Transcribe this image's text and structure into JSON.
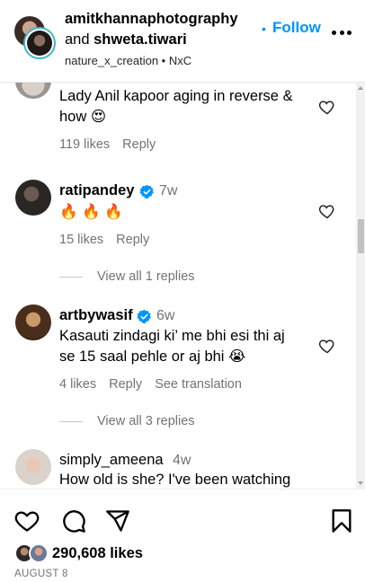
{
  "header": {
    "user1": "amitkhannaphotography",
    "and_text": "and",
    "user2": "shweta.tiwari",
    "follow_dot": "•",
    "follow_label": "Follow",
    "subtitle": "nature_x_creation • NxC"
  },
  "comments": [
    {
      "username": "",
      "time": "",
      "text_line1": "Lady Anil kapoor aging in reverse &",
      "text_line2": "how 😍",
      "likes": "119 likes",
      "reply": "Reply"
    },
    {
      "username": "ratipandey",
      "verified": true,
      "time": "7w",
      "text_line1": "🔥 🔥 🔥",
      "likes": "15 likes",
      "reply": "Reply",
      "view_replies": "View all 1 replies"
    },
    {
      "username": "artbywasif",
      "verified": true,
      "time": "6w",
      "text_line1": "Kasauti zindagi ki’ me bhi esi thi aj",
      "text_line2": "se 15 saal pehle or aj bhi 😭",
      "likes": "4 likes",
      "reply": "Reply",
      "translation": "See translation",
      "view_replies": "View all 3 replies"
    },
    {
      "username": "simply_ameena",
      "time": "4w",
      "text_line1": "How old is she? I've been watching"
    }
  ],
  "actions": {
    "likes_count": "290,608 likes",
    "date": "AUGUST 8"
  },
  "colors": {
    "accent": "#0095f6",
    "muted": "#737373",
    "verified": "#0095f6"
  },
  "icons": [
    "heart-icon",
    "comment-icon",
    "share-icon",
    "bookmark-icon",
    "more-icon",
    "verified-icon"
  ]
}
